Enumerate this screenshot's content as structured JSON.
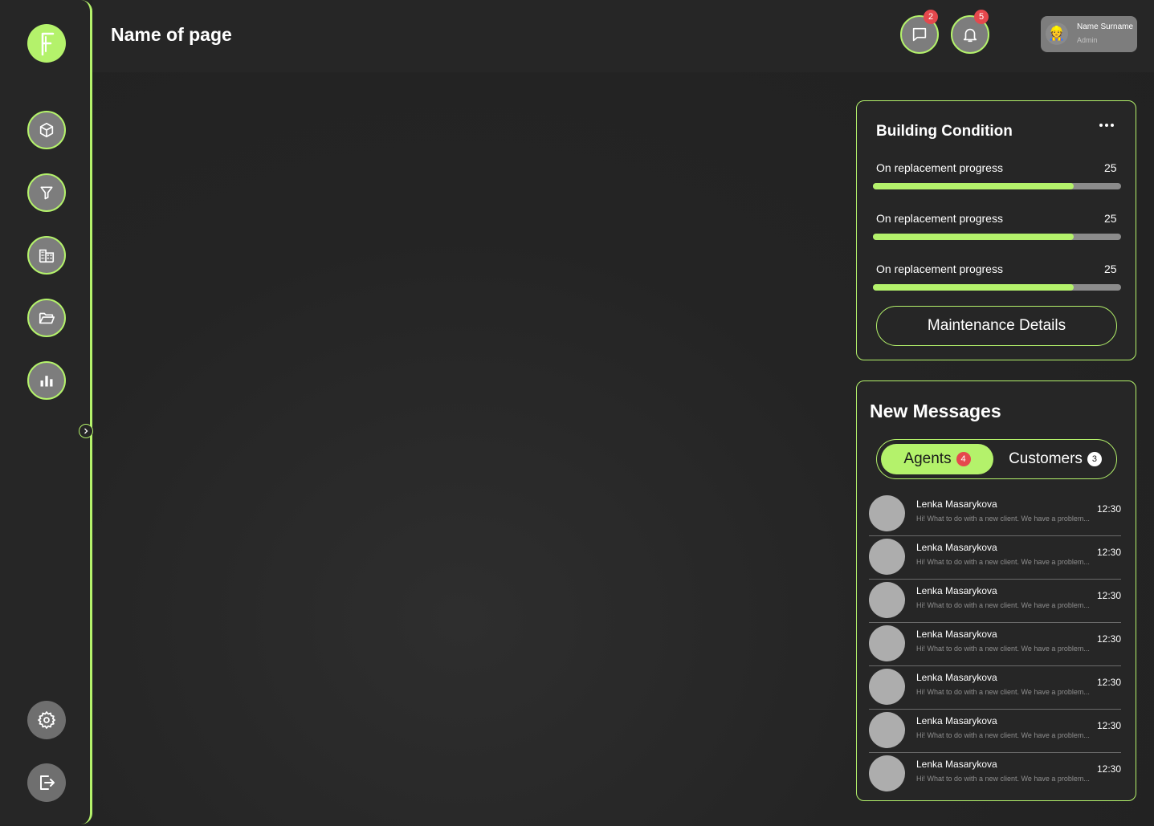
{
  "header": {
    "page_title": "Name of page",
    "messages_badge": "2",
    "notifications_badge": "5",
    "user": {
      "name": "Name Surname",
      "role": "Admin"
    }
  },
  "sidebar": {
    "items": [
      {
        "icon": "cube-icon"
      },
      {
        "icon": "filter-icon"
      },
      {
        "icon": "building-icon"
      },
      {
        "icon": "folder-icon"
      },
      {
        "icon": "bar-chart-icon"
      },
      {
        "icon": "gear-icon"
      },
      {
        "icon": "logout-icon"
      }
    ]
  },
  "building_condition": {
    "title": "Building Condition",
    "items": [
      {
        "label": "On replacement progress",
        "value": "25",
        "progress": 0.81
      },
      {
        "label": "On replacement progress",
        "value": "25",
        "progress": 0.81
      },
      {
        "label": "On replacement progress",
        "value": "25",
        "progress": 0.81
      }
    ],
    "button_label": "Maintenance Details"
  },
  "new_messages": {
    "title": "New Messages",
    "tabs": [
      {
        "label": "Agents",
        "count": "4"
      },
      {
        "label": "Customers",
        "count": "3"
      }
    ],
    "messages": [
      {
        "name": "Lenka Masarykova",
        "time": "12:30",
        "preview": "Hi! What to do with a new client. We have a problem..."
      },
      {
        "name": "Lenka Masarykova",
        "time": "12:30",
        "preview": "Hi! What to do with a new client. We have a problem..."
      },
      {
        "name": "Lenka Masarykova",
        "time": "12:30",
        "preview": "Hi! What to do with a new client. We have a problem..."
      },
      {
        "name": "Lenka Masarykova",
        "time": "12:30",
        "preview": "Hi! What to do with a new client. We have a problem..."
      },
      {
        "name": "Lenka Masarykova",
        "time": "12:30",
        "preview": "Hi! What to do with a new client. We have a problem..."
      },
      {
        "name": "Lenka Masarykova",
        "time": "12:30",
        "preview": "Hi! What to do with a new client. We have a problem..."
      },
      {
        "name": "Lenka Masarykova",
        "time": "12:30",
        "preview": "Hi! What to do with a new client. We have a problem..."
      }
    ]
  },
  "colors": {
    "accent": "#b4f26b",
    "badge": "#e5484d",
    "background": "#232323"
  }
}
